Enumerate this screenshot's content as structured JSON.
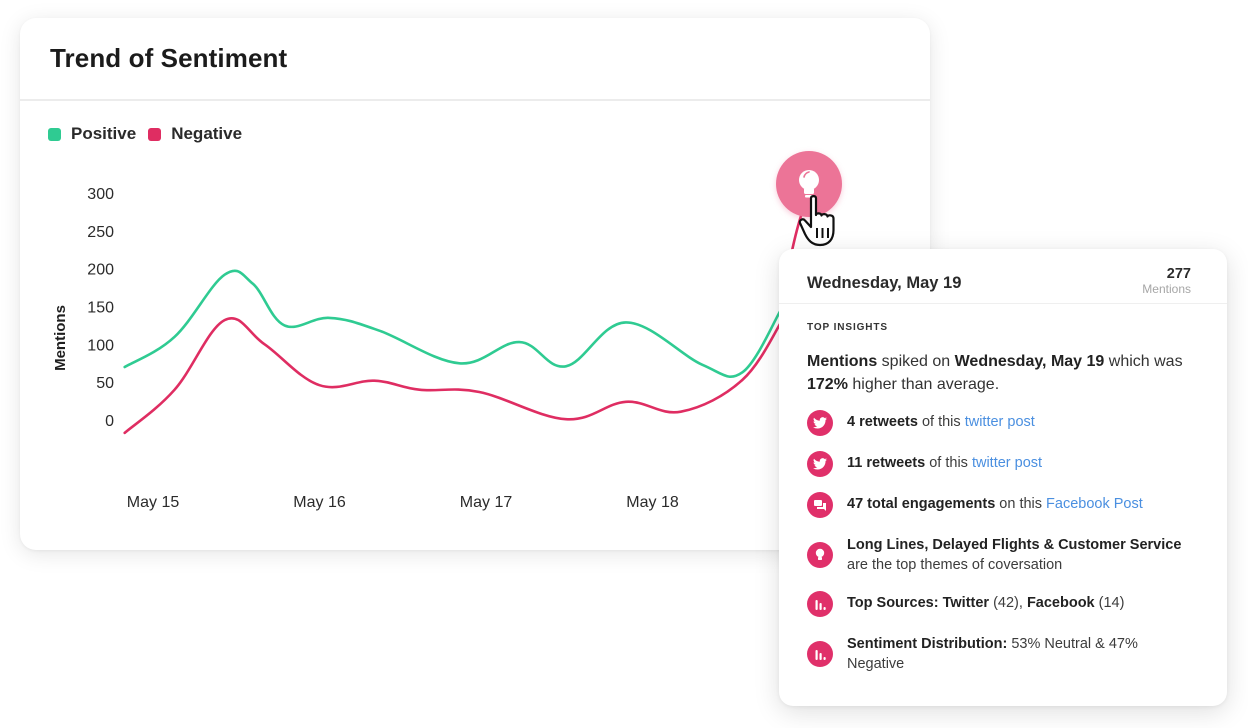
{
  "card": {
    "title": "Trend of Sentiment"
  },
  "colors": {
    "positive": "#2fcb92",
    "negative": "#df2d62",
    "insight_button": "#ec7497",
    "icon_badge": "#e0306a",
    "link": "#4a8fe0"
  },
  "chart_data": {
    "type": "line",
    "title": "Trend of Sentiment",
    "xlabel": "",
    "ylabel": "Mentions",
    "x_ticks": [
      "May 15",
      "May 16",
      "May 17",
      "May 18"
    ],
    "y_ticks": [
      0,
      50,
      100,
      150,
      200,
      250,
      300
    ],
    "ylim": [
      0,
      300
    ],
    "grid": false,
    "legend": {
      "placement": "top-left",
      "entries": [
        "Positive",
        "Negative"
      ]
    },
    "x_unit": "days since May 15",
    "series": [
      {
        "name": "Positive",
        "color": "#2fcb92",
        "points": [
          [
            -0.17,
            70
          ],
          [
            0.13,
            110
          ],
          [
            0.43,
            192
          ],
          [
            0.6,
            180
          ],
          [
            0.79,
            125
          ],
          [
            1.06,
            135
          ],
          [
            1.36,
            118
          ],
          [
            1.84,
            75
          ],
          [
            2.2,
            103
          ],
          [
            2.48,
            71
          ],
          [
            2.84,
            129
          ],
          [
            3.3,
            73
          ],
          [
            3.54,
            63
          ],
          [
            3.77,
            145
          ]
        ]
      },
      {
        "name": "Negative",
        "color": "#df2d62",
        "points": [
          [
            -0.17,
            -17
          ],
          [
            0.13,
            40
          ],
          [
            0.43,
            132
          ],
          [
            0.67,
            100
          ],
          [
            1.0,
            46
          ],
          [
            1.33,
            52
          ],
          [
            1.6,
            40
          ],
          [
            1.96,
            37
          ],
          [
            2.48,
            1
          ],
          [
            2.84,
            24
          ],
          [
            3.17,
            11
          ],
          [
            3.54,
            53
          ],
          [
            3.78,
            132
          ]
        ]
      }
    ],
    "highlight": {
      "x_label": "May 19",
      "total_mentions": 277
    }
  },
  "insight_button": {
    "icon": "lightbulb-icon"
  },
  "tooltip": {
    "date": "Wednesday, May 19",
    "count": "277",
    "count_label": "Mentions",
    "section_label": "TOP INSIGHTS",
    "summary": {
      "bold1": "Mentions",
      "text1": " spiked on ",
      "bold2": "Wednesday, May 19",
      "text2": " which was ",
      "bold3": "172%",
      "text3": " higher than average."
    },
    "insights": [
      {
        "icon": "twitter-icon",
        "bold": "4 retweets",
        "text": " of this ",
        "link": "twitter post"
      },
      {
        "icon": "twitter-icon",
        "bold": "11 retweets",
        "text": " of this ",
        "link": "twitter post"
      },
      {
        "icon": "chat-icon",
        "bold": "47 total engagements",
        "text": " on this ",
        "link": "Facebook Post"
      },
      {
        "icon": "lightbulb-icon",
        "bold": "Long Lines, Delayed Flights & Customer Service",
        "text": " are the top themes of coversation"
      },
      {
        "icon": "bar-chart-icon",
        "bold": "Top Sources: Twitter",
        "text": " (42), ",
        "bold2": "Facebook",
        "text2": " (14)"
      },
      {
        "icon": "bar-chart-icon",
        "bold": "Sentiment Distribution:",
        "text": " 53% Neutral & 47% Negative"
      }
    ]
  }
}
